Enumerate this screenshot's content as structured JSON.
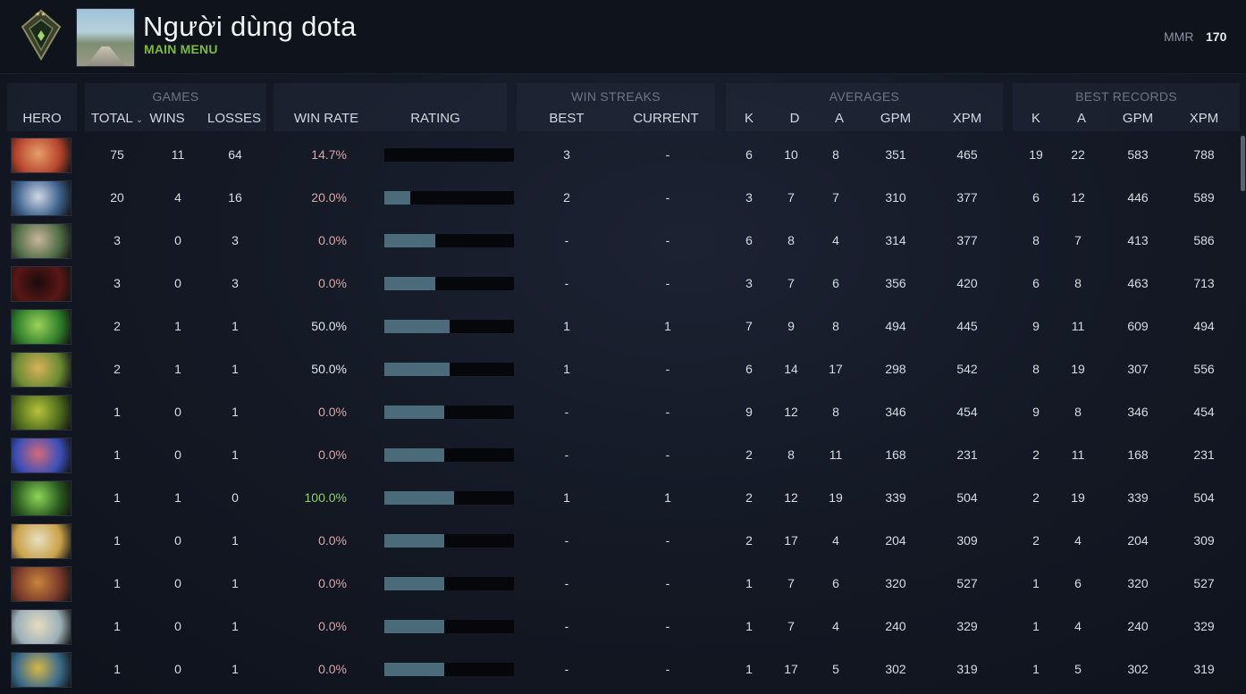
{
  "header": {
    "username": "Người dùng dota",
    "submenu": "MAIN MENU",
    "mmr_label": "MMR",
    "mmr_value": "170"
  },
  "groups": {
    "games": "GAMES",
    "win_streaks": "WIN STREAKS",
    "averages": "AVERAGES",
    "best_records": "BEST RECORDS"
  },
  "columns": {
    "hero": "HERO",
    "total": "TOTAL",
    "wins": "WINS",
    "losses": "LOSSES",
    "win_rate": "WIN RATE",
    "rating": "RATING",
    "best": "BEST",
    "current": "CURRENT",
    "avg_k": "K",
    "avg_d": "D",
    "avg_a": "A",
    "avg_gpm": "GPM",
    "avg_xpm": "XPM",
    "best_k": "K",
    "best_a": "A",
    "best_gpm": "GPM",
    "best_xpm": "XPM"
  },
  "colors": {
    "win_rate_low": "#d9a7a7",
    "win_rate_mid": "#e3e6ea",
    "win_rate_high": "#8fcf6b",
    "rating_bar": "#4b6b7a"
  },
  "rows": [
    {
      "hero_icon": "axe-portrait",
      "total": "75",
      "wins": "11",
      "losses": "64",
      "win_rate": "14.7%",
      "rating": 0.0,
      "best": "3",
      "current": "-",
      "k": "6",
      "d": "10",
      "a": "8",
      "gpm": "351",
      "xpm": "465",
      "bk": "19",
      "ba": "22",
      "bgpm": "583",
      "bxpm": "788"
    },
    {
      "hero_icon": "drow-ranger-portrait",
      "total": "20",
      "wins": "4",
      "losses": "16",
      "win_rate": "20.0%",
      "rating": 0.2,
      "best": "2",
      "current": "-",
      "k": "3",
      "d": "7",
      "a": "7",
      "gpm": "310",
      "xpm": "377",
      "bk": "6",
      "ba": "12",
      "bgpm": "446",
      "bxpm": "589"
    },
    {
      "hero_icon": "sniper-portrait",
      "total": "3",
      "wins": "0",
      "losses": "3",
      "win_rate": "0.0%",
      "rating": 0.39,
      "best": "-",
      "current": "-",
      "k": "6",
      "d": "8",
      "a": "4",
      "gpm": "314",
      "xpm": "377",
      "bk": "8",
      "ba": "7",
      "bgpm": "413",
      "bxpm": "586"
    },
    {
      "hero_icon": "shadow-fiend-portrait",
      "total": "3",
      "wins": "0",
      "losses": "3",
      "win_rate": "0.0%",
      "rating": 0.39,
      "best": "-",
      "current": "-",
      "k": "3",
      "d": "7",
      "a": "6",
      "gpm": "356",
      "xpm": "420",
      "bk": "6",
      "ba": "8",
      "bgpm": "463",
      "bxpm": "713"
    },
    {
      "hero_icon": "viper-portrait",
      "total": "2",
      "wins": "1",
      "losses": "1",
      "win_rate": "50.0%",
      "rating": 0.5,
      "best": "1",
      "current": "1",
      "k": "7",
      "d": "9",
      "a": "8",
      "gpm": "494",
      "xpm": "445",
      "bk": "9",
      "ba": "11",
      "bgpm": "609",
      "bxpm": "494"
    },
    {
      "hero_icon": "windranger-portrait",
      "total": "2",
      "wins": "1",
      "losses": "1",
      "win_rate": "50.0%",
      "rating": 0.5,
      "best": "1",
      "current": "-",
      "k": "6",
      "d": "14",
      "a": "17",
      "gpm": "298",
      "xpm": "542",
      "bk": "8",
      "ba": "19",
      "bgpm": "307",
      "bxpm": "556"
    },
    {
      "hero_icon": "nature-prophet-portrait",
      "total": "1",
      "wins": "0",
      "losses": "1",
      "win_rate": "0.0%",
      "rating": 0.46,
      "best": "-",
      "current": "-",
      "k": "9",
      "d": "12",
      "a": "8",
      "gpm": "346",
      "xpm": "454",
      "bk": "9",
      "ba": "8",
      "bgpm": "346",
      "bxpm": "454"
    },
    {
      "hero_icon": "witch-doctor-portrait",
      "total": "1",
      "wins": "0",
      "losses": "1",
      "win_rate": "0.0%",
      "rating": 0.46,
      "best": "-",
      "current": "-",
      "k": "2",
      "d": "8",
      "a": "11",
      "gpm": "168",
      "xpm": "231",
      "bk": "2",
      "ba": "11",
      "bgpm": "168",
      "bxpm": "231"
    },
    {
      "hero_icon": "rubick-portrait",
      "total": "1",
      "wins": "1",
      "losses": "0",
      "win_rate": "100.0%",
      "rating": 0.54,
      "best": "1",
      "current": "1",
      "k": "2",
      "d": "12",
      "a": "19",
      "gpm": "339",
      "xpm": "504",
      "bk": "2",
      "ba": "19",
      "bgpm": "339",
      "bxpm": "504"
    },
    {
      "hero_icon": "keeper-of-the-light-portrait",
      "total": "1",
      "wins": "0",
      "losses": "1",
      "win_rate": "0.0%",
      "rating": 0.46,
      "best": "-",
      "current": "-",
      "k": "2",
      "d": "17",
      "a": "4",
      "gpm": "204",
      "xpm": "309",
      "bk": "2",
      "ba": "4",
      "bgpm": "204",
      "bxpm": "309"
    },
    {
      "hero_icon": "troll-warlord-portrait",
      "total": "1",
      "wins": "0",
      "losses": "1",
      "win_rate": "0.0%",
      "rating": 0.46,
      "best": "-",
      "current": "-",
      "k": "1",
      "d": "7",
      "a": "6",
      "gpm": "320",
      "xpm": "527",
      "bk": "1",
      "ba": "6",
      "bgpm": "320",
      "bxpm": "527"
    },
    {
      "hero_icon": "omniknight-portrait",
      "total": "1",
      "wins": "0",
      "losses": "1",
      "win_rate": "0.0%",
      "rating": 0.46,
      "best": "-",
      "current": "-",
      "k": "1",
      "d": "7",
      "a": "4",
      "gpm": "240",
      "xpm": "329",
      "bk": "1",
      "ba": "4",
      "bgpm": "240",
      "bxpm": "329"
    },
    {
      "hero_icon": "tinker-portrait",
      "total": "1",
      "wins": "0",
      "losses": "1",
      "win_rate": "0.0%",
      "rating": 0.46,
      "best": "-",
      "current": "-",
      "k": "1",
      "d": "17",
      "a": "5",
      "gpm": "302",
      "xpm": "319",
      "bk": "1",
      "ba": "5",
      "bgpm": "302",
      "bxpm": "319"
    }
  ]
}
